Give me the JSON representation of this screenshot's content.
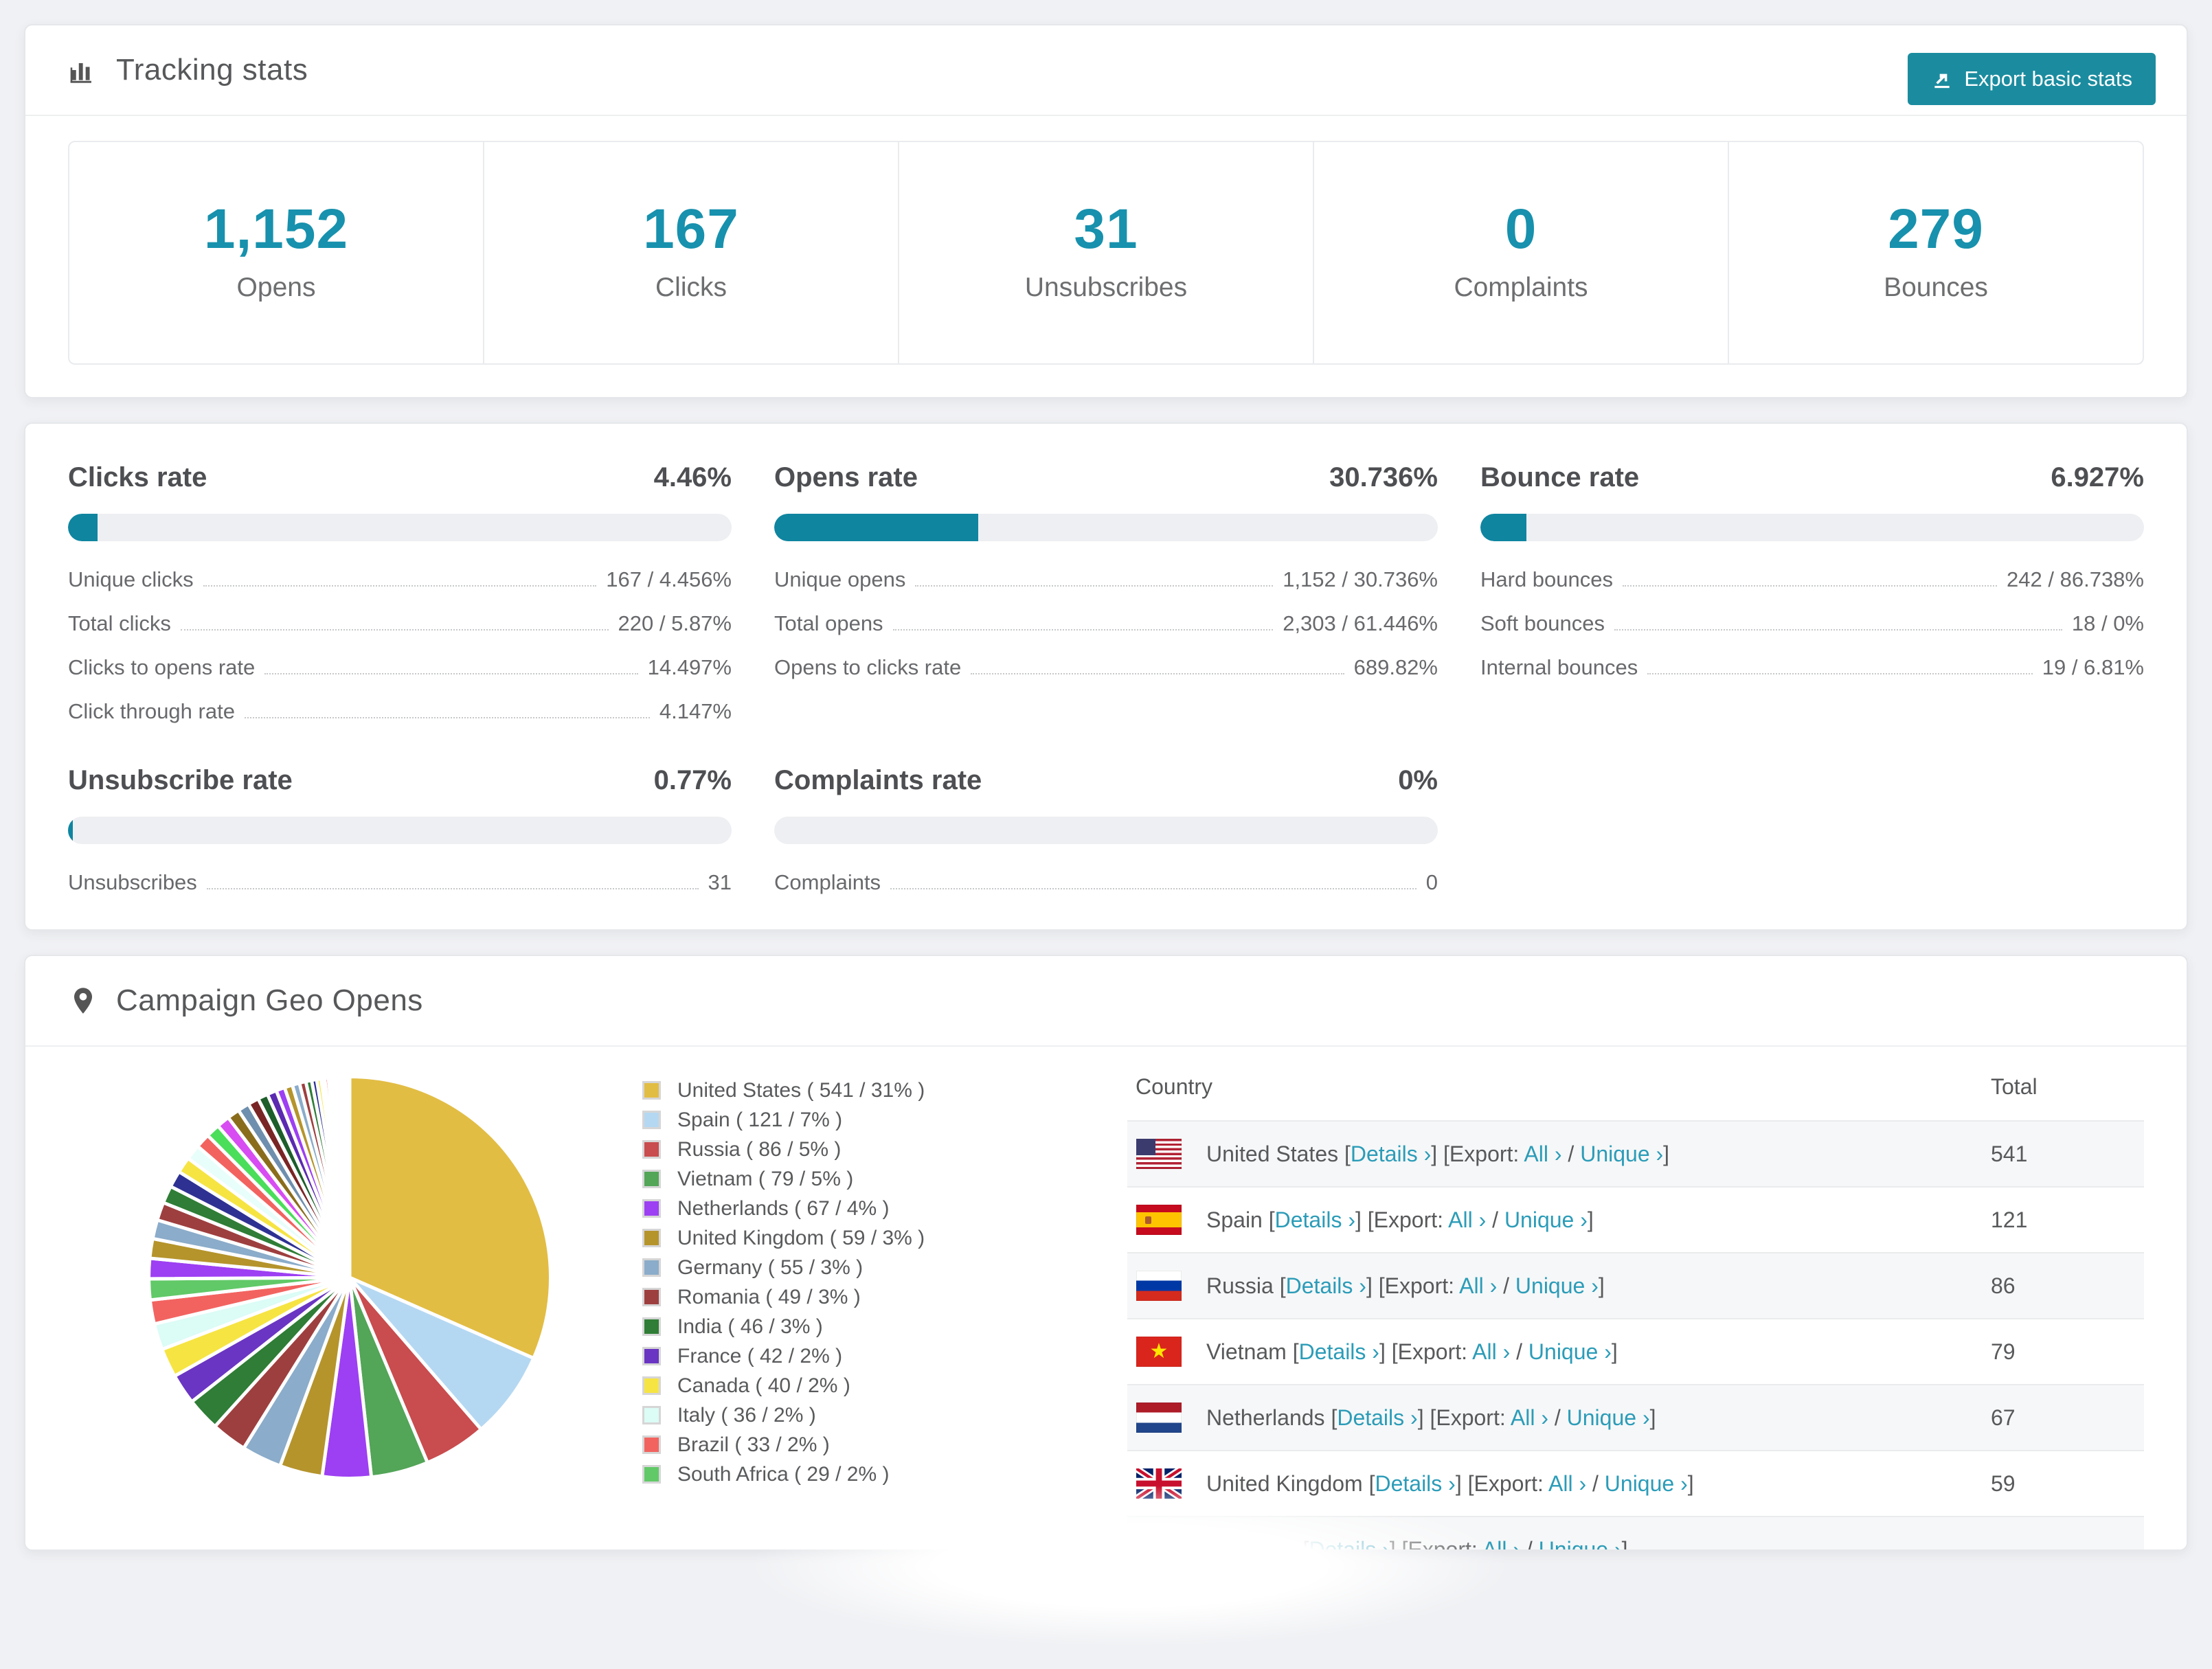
{
  "accent": "#0f85a0",
  "tracking": {
    "title": "Tracking stats",
    "export_label": "Export basic stats",
    "summary": [
      {
        "value": "1,152",
        "label": "Opens"
      },
      {
        "value": "167",
        "label": "Clicks"
      },
      {
        "value": "31",
        "label": "Unsubscribes"
      },
      {
        "value": "0",
        "label": "Complaints"
      },
      {
        "value": "279",
        "label": "Bounces"
      }
    ]
  },
  "rates": [
    {
      "title": "Clicks rate",
      "value": "4.46%",
      "pct": 4.46,
      "items": [
        {
          "label": "Unique clicks",
          "value": "167 / 4.456%"
        },
        {
          "label": "Total clicks",
          "value": "220 / 5.87%"
        },
        {
          "label": "Clicks to opens rate",
          "value": "14.497%"
        },
        {
          "label": "Click through rate",
          "value": "4.147%"
        }
      ]
    },
    {
      "title": "Opens rate",
      "value": "30.736%",
      "pct": 30.736,
      "items": [
        {
          "label": "Unique opens",
          "value": "1,152 / 30.736%"
        },
        {
          "label": "Total opens",
          "value": "2,303 / 61.446%"
        },
        {
          "label": "Opens to clicks rate",
          "value": "689.82%"
        }
      ]
    },
    {
      "title": "Bounce rate",
      "value": "6.927%",
      "pct": 6.927,
      "items": [
        {
          "label": "Hard bounces",
          "value": "242 / 86.738%"
        },
        {
          "label": "Soft bounces",
          "value": "18 / 0%"
        },
        {
          "label": "Internal bounces",
          "value": "19 / 6.81%"
        }
      ]
    },
    {
      "title": "Unsubscribe rate",
      "value": "0.77%",
      "pct": 0.77,
      "items": [
        {
          "label": "Unsubscribes",
          "value": "31"
        }
      ]
    },
    {
      "title": "Complaints rate",
      "value": "0%",
      "pct": 0,
      "items": [
        {
          "label": "Complaints",
          "value": "0"
        }
      ]
    }
  ],
  "geo": {
    "title": "Campaign Geo Opens",
    "legend": [
      {
        "label": "United States ( 541 / 31% )",
        "color": "#e2bd44"
      },
      {
        "label": "Spain ( 121 / 7% )",
        "color": "#b5d8f2"
      },
      {
        "label": "Russia ( 86 / 5% )",
        "color": "#c94c4e"
      },
      {
        "label": "Vietnam ( 79 / 5% )",
        "color": "#53a558"
      },
      {
        "label": "Netherlands ( 67 / 4% )",
        "color": "#9d3ff2"
      },
      {
        "label": "United Kingdom ( 59 / 3% )",
        "color": "#b5942c"
      },
      {
        "label": "Germany ( 55 / 3% )",
        "color": "#8bacca"
      },
      {
        "label": "Romania ( 49 / 3% )",
        "color": "#9e3f3f"
      },
      {
        "label": "India ( 46 / 3% )",
        "color": "#2f7d36"
      },
      {
        "label": "France ( 42 / 2% )",
        "color": "#6a35c2"
      },
      {
        "label": "Canada ( 40 / 2% )",
        "color": "#f6e443"
      },
      {
        "label": "Italy ( 36 / 2% )",
        "color": "#dcfcf6"
      },
      {
        "label": "Brazil ( 33 / 2% )",
        "color": "#f26360"
      },
      {
        "label": "South Africa ( 29 / 2% )",
        "color": "#61c968"
      }
    ],
    "links": {
      "details": "Details ›",
      "export_prefix": "Export:",
      "all": "All ›",
      "unique": "Unique ›"
    },
    "table": {
      "headers": [
        "Country",
        "Total"
      ],
      "rows": [
        {
          "country": "United States",
          "flag": "us",
          "total": "541"
        },
        {
          "country": "Spain",
          "flag": "es",
          "total": "121"
        },
        {
          "country": "Russia",
          "flag": "ru",
          "total": "86"
        },
        {
          "country": "Vietnam",
          "flag": "vn",
          "total": "79"
        },
        {
          "country": "Netherlands",
          "flag": "nl",
          "total": "67"
        },
        {
          "country": "United Kingdom",
          "flag": "gb",
          "total": "59"
        },
        {
          "country": "Germany",
          "flag": "de",
          "total": ""
        }
      ]
    }
  },
  "chart_data": {
    "type": "pie",
    "title": "Campaign Geo Opens",
    "legend_position": "right",
    "start_angle_deg": -90,
    "direction": "clockwise",
    "categories": [
      "United States",
      "Spain",
      "Russia",
      "Vietnam",
      "Netherlands",
      "United Kingdom",
      "Germany",
      "Romania",
      "India",
      "France",
      "Canada",
      "Italy",
      "Brazil",
      "South Africa"
    ],
    "values": [
      541,
      121,
      86,
      79,
      67,
      59,
      55,
      49,
      46,
      42,
      40,
      36,
      33,
      29
    ],
    "percent_labels": [
      "31%",
      "7%",
      "5%",
      "5%",
      "4%",
      "3%",
      "3%",
      "3%",
      "3%",
      "2%",
      "2%",
      "2%",
      "2%",
      "2%"
    ],
    "colors": [
      "#e2bd44",
      "#b5d8f2",
      "#c94c4e",
      "#53a558",
      "#9d3ff2",
      "#b5942c",
      "#8bacca",
      "#9e3f3f",
      "#2f7d36",
      "#6a35c2",
      "#f6e443",
      "#dcfcf6",
      "#f26360",
      "#61c968"
    ],
    "others_values": [
      28,
      27,
      26,
      25,
      24,
      23,
      22,
      21,
      20,
      19,
      18,
      17,
      16,
      15,
      14,
      13,
      12,
      11,
      10,
      9,
      8,
      7,
      6,
      5,
      5,
      4,
      4,
      3,
      3,
      2,
      2,
      2,
      2,
      1,
      1,
      1,
      1,
      1,
      1,
      1
    ],
    "others_palette": [
      "#9d3ff2",
      "#b5942c",
      "#8bacca",
      "#9e3f3f",
      "#2f7d36",
      "#2e3192",
      "#f6e443",
      "#e8fefa",
      "#f26360",
      "#4ade5a",
      "#d74df2",
      "#8a6d1c",
      "#6f8fae",
      "#7a2525",
      "#1d5e2a",
      "#5b2ab0"
    ]
  }
}
